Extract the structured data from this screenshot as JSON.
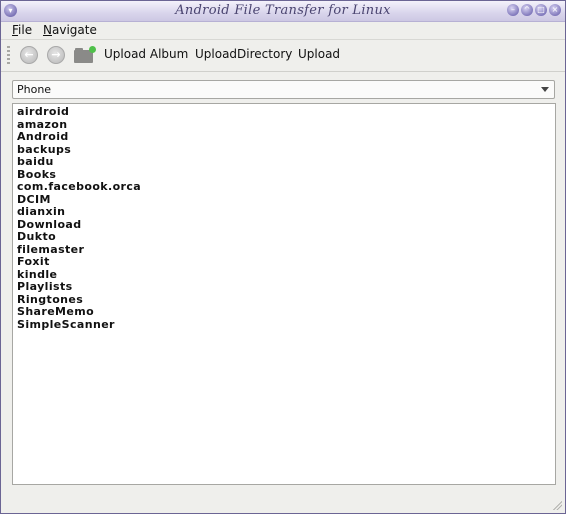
{
  "window": {
    "title": "Android File Transfer for Linux"
  },
  "menubar": {
    "file": "File",
    "navigate": "Navigate"
  },
  "toolbar": {
    "back_icon": "arrow-left-icon",
    "forward_icon": "arrow-right-icon",
    "new_folder_icon": "new-folder-icon",
    "upload_album": "Upload Album",
    "upload_directory": "UploadDirectory",
    "upload": "Upload"
  },
  "storage": {
    "selected": "Phone"
  },
  "files": [
    "airdroid",
    "amazon",
    "Android",
    "backups",
    "baidu",
    "Books",
    "com.facebook.orca",
    "DCIM",
    "dianxin",
    "Download",
    "Dukto",
    "filemaster",
    "Foxit",
    "kindle",
    "Playlists",
    "Ringtones",
    "ShareMemo",
    "SimpleScanner"
  ],
  "colors": {
    "titlebar": "#d9d5ec",
    "accent": "#5a52a0",
    "new_folder_badge": "#4fc04a"
  }
}
